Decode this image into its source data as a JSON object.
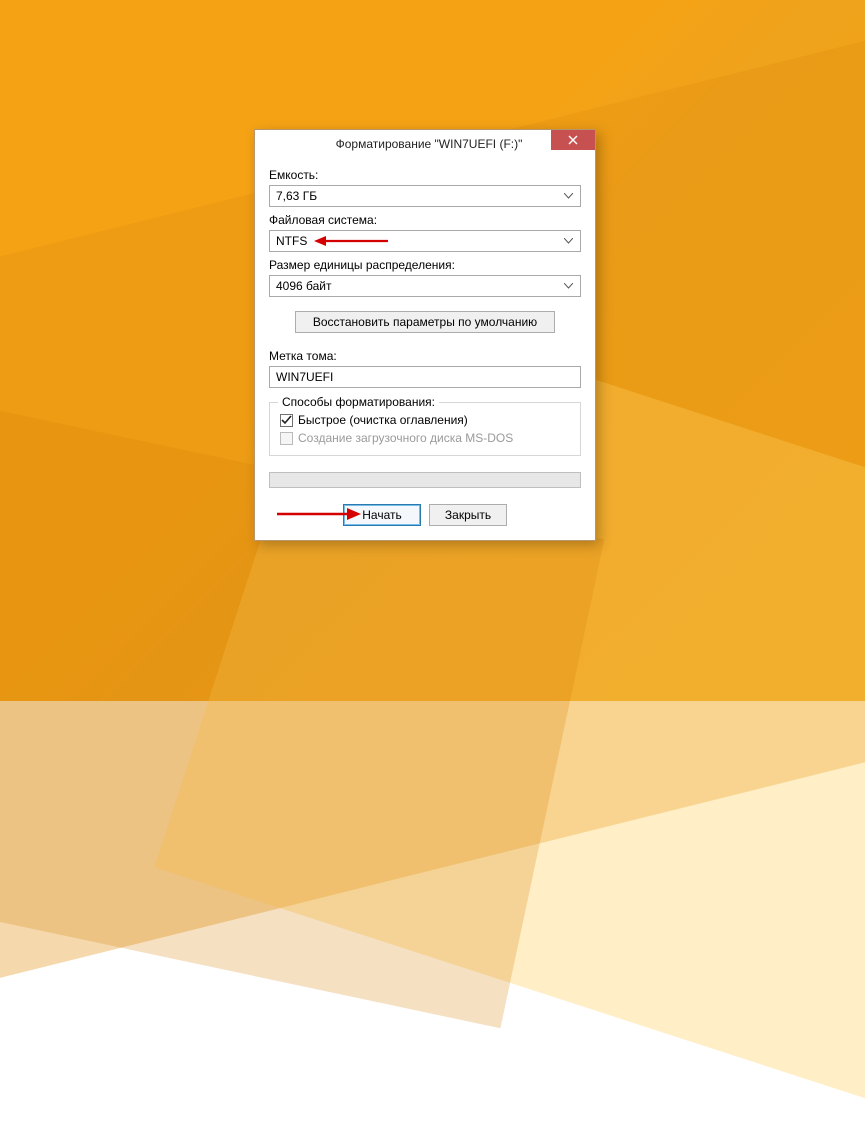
{
  "window": {
    "title": "Форматирование \"WIN7UEFI (F:)\""
  },
  "fields": {
    "capacity_label": "Емкость:",
    "capacity_value": "7,63 ГБ",
    "filesystem_label": "Файловая система:",
    "filesystem_value": "NTFS",
    "alloc_label": "Размер единицы распределения:",
    "alloc_value": "4096 байт",
    "restore_defaults": "Восстановить параметры по умолчанию",
    "volume_label": "Метка тома:",
    "volume_value": "WIN7UEFI"
  },
  "format_options": {
    "group_title": "Способы форматирования:",
    "quick_label": "Быстрое (очистка оглавления)",
    "quick_checked": true,
    "msdos_label": "Создание загрузочного диска MS-DOS",
    "msdos_checked": false
  },
  "buttons": {
    "start": "Начать",
    "close": "Закрыть"
  }
}
